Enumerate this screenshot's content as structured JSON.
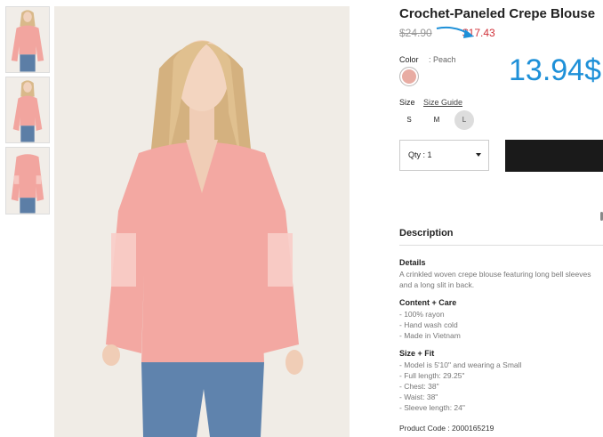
{
  "product": {
    "title": "Crochet-Paneled Crepe Blouse",
    "old_price": "$24.90",
    "new_price": "$17.43",
    "big_price": "13.94$",
    "color_label": "Color",
    "color_value": ":  Peach",
    "swatch_color": "#e8aca3",
    "size_label": "Size",
    "size_guide": "Size Guide",
    "sizes": [
      "S",
      "M",
      "L"
    ],
    "selected_size": "L",
    "quantity": "Qty : 1",
    "product_code": "Product Code : 2000165219"
  },
  "description": {
    "heading": "Description",
    "details_heading": "Details",
    "details_line1": "A crinkled woven crepe blouse featuring long bell sleeves",
    "details_line2": "and a long slit in back.",
    "care_heading": "Content + Care",
    "care_items": [
      "- 100% rayon",
      "- Hand wash cold",
      "- Made in Vietnam"
    ],
    "fit_heading": "Size + Fit",
    "fit_items": [
      "- Model is 5'10\" and wearing a Small",
      "- Full length: 29.25\"",
      "- Chest: 38\"",
      "- Waist: 38\"",
      "- Sleeve length: 24\""
    ]
  },
  "colors": {
    "accent_blue": "#1e90d8",
    "sale_red": "#d0323a",
    "button_dark": "#1a1a1a"
  }
}
